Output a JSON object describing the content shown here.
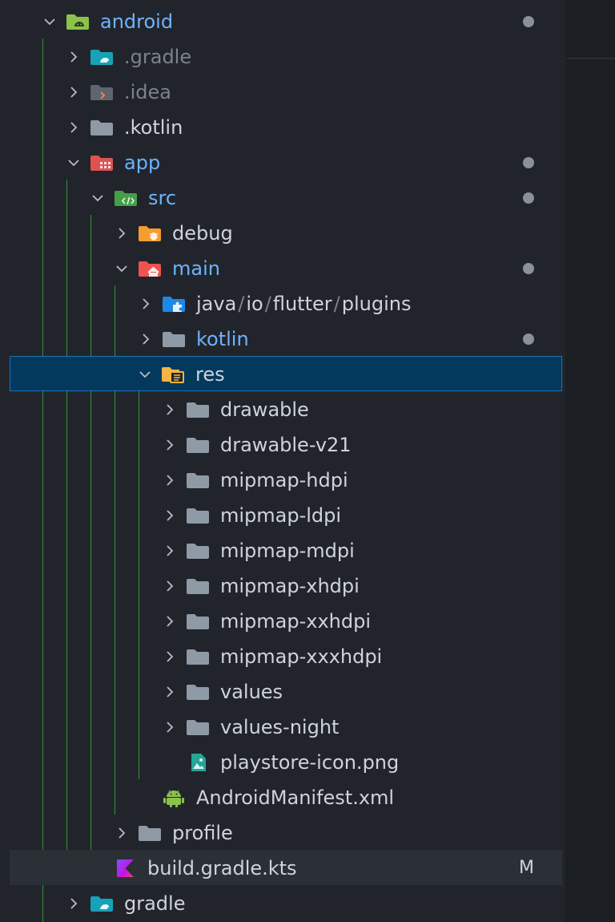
{
  "colors": {
    "background": "#21252b",
    "selected_row": "#04395e",
    "selected_border": "#1f6fb6",
    "modified_text": "#6fb2ff",
    "guide_line": "#3a8f3a",
    "folder_gray": "#8e9aa6"
  },
  "tree": [
    {
      "label": "android",
      "depth": 0,
      "expanded": true,
      "icon": "android-folder-icon",
      "modified": true
    },
    {
      "label": ".gradle",
      "depth": 1,
      "expanded": false,
      "icon": "gradle-folder-icon",
      "dim": true
    },
    {
      "label": ".idea",
      "depth": 1,
      "expanded": false,
      "icon": "idea-folder-icon",
      "dim": true
    },
    {
      "label": ".kotlin",
      "depth": 1,
      "expanded": false,
      "icon": "folder-icon"
    },
    {
      "label": "app",
      "depth": 1,
      "expanded": true,
      "icon": "app-folder-icon",
      "modified": true
    },
    {
      "label": "src",
      "depth": 2,
      "expanded": true,
      "icon": "src-folder-icon",
      "modified": true
    },
    {
      "label": "debug",
      "depth": 3,
      "expanded": false,
      "icon": "debug-folder-icon"
    },
    {
      "label": "main",
      "depth": 3,
      "expanded": true,
      "icon": "main-folder-icon",
      "modified": true
    },
    {
      "label": "",
      "parts": [
        "java",
        "io",
        "flutter",
        "plugins"
      ],
      "depth": 4,
      "expanded": false,
      "icon": "plugin-folder-icon"
    },
    {
      "label": "kotlin",
      "depth": 4,
      "expanded": false,
      "icon": "folder-icon",
      "modified": true
    },
    {
      "label": "res",
      "depth": 4,
      "expanded": true,
      "icon": "res-folder-icon",
      "selected": true
    },
    {
      "label": "drawable",
      "depth": 5,
      "expanded": false,
      "icon": "folder-icon"
    },
    {
      "label": "drawable-v21",
      "depth": 5,
      "expanded": false,
      "icon": "folder-icon"
    },
    {
      "label": "mipmap-hdpi",
      "depth": 5,
      "expanded": false,
      "icon": "folder-icon"
    },
    {
      "label": "mipmap-ldpi",
      "depth": 5,
      "expanded": false,
      "icon": "folder-icon"
    },
    {
      "label": "mipmap-mdpi",
      "depth": 5,
      "expanded": false,
      "icon": "folder-icon"
    },
    {
      "label": "mipmap-xhdpi",
      "depth": 5,
      "expanded": false,
      "icon": "folder-icon"
    },
    {
      "label": "mipmap-xxhdpi",
      "depth": 5,
      "expanded": false,
      "icon": "folder-icon"
    },
    {
      "label": "mipmap-xxxhdpi",
      "depth": 5,
      "expanded": false,
      "icon": "folder-icon"
    },
    {
      "label": "values",
      "depth": 5,
      "expanded": false,
      "icon": "folder-icon"
    },
    {
      "label": "values-night",
      "depth": 5,
      "expanded": false,
      "icon": "folder-icon"
    },
    {
      "label": "playstore-icon.png",
      "depth": 5,
      "file": true,
      "icon": "image-file-icon"
    },
    {
      "label": "AndroidManifest.xml",
      "depth": 4,
      "file": true,
      "icon": "android-file-icon"
    },
    {
      "label": "profile",
      "depth": 3,
      "expanded": false,
      "icon": "folder-icon"
    },
    {
      "label": "build.gradle.kts",
      "depth": 2,
      "file": true,
      "icon": "kotlin-file-icon",
      "hovered": true,
      "badge": "M"
    },
    {
      "label": "gradle",
      "depth": 1,
      "expanded": false,
      "icon": "gradle-folder-icon"
    }
  ]
}
